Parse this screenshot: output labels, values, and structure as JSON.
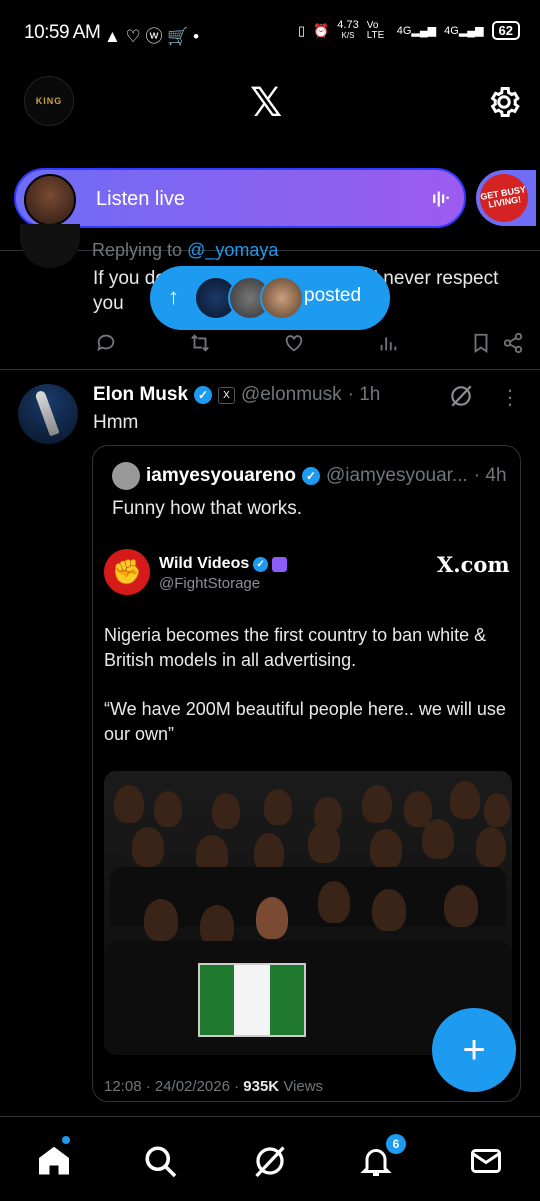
{
  "status_bar": {
    "time": "10:59 AM",
    "left_icons": "▲ ♡ ⓦ 🛒 •",
    "speed": "4.73",
    "speed_unit": "K/S",
    "net1": "Vo LTE",
    "net2": "4G",
    "net3": "4G",
    "battery": "62"
  },
  "header": {
    "logo": "𝕏",
    "avatar_label": "KING"
  },
  "spaces": {
    "label": "Listen live",
    "second_label": "GET BUSY LIVING!"
  },
  "tweet1": {
    "replying": "Replying to",
    "replying_handle": "@_yomaya",
    "text": "If you don't respect yourself they'll never respect you"
  },
  "posted_pill": {
    "label": "posted"
  },
  "tweet2": {
    "name": "Elon Musk",
    "handle": "@elonmusk",
    "time": "· 1h",
    "text": "Hmm"
  },
  "quote": {
    "name": "iamyesyouareno",
    "handle": "@iamyesyouar...",
    "time": "· 4h",
    "text": "Funny how that works.",
    "embed": {
      "name": "Wild Videos",
      "handle": "@FightStorage",
      "site": "X.com",
      "para1": "Nigeria becomes the first country to ban white & British models in all advertising.",
      "para2": "“We have 200M beautiful people here.. we will use our own”",
      "time": "12:08 · 24/02/2026 ·",
      "views_count": "935K",
      "views_label": "Views"
    }
  },
  "nav": {
    "notifications_badge": "6"
  },
  "colors": {
    "accent": "#1d9bf0",
    "background": "#000000",
    "spaces_gradient": "#8a63f0"
  }
}
